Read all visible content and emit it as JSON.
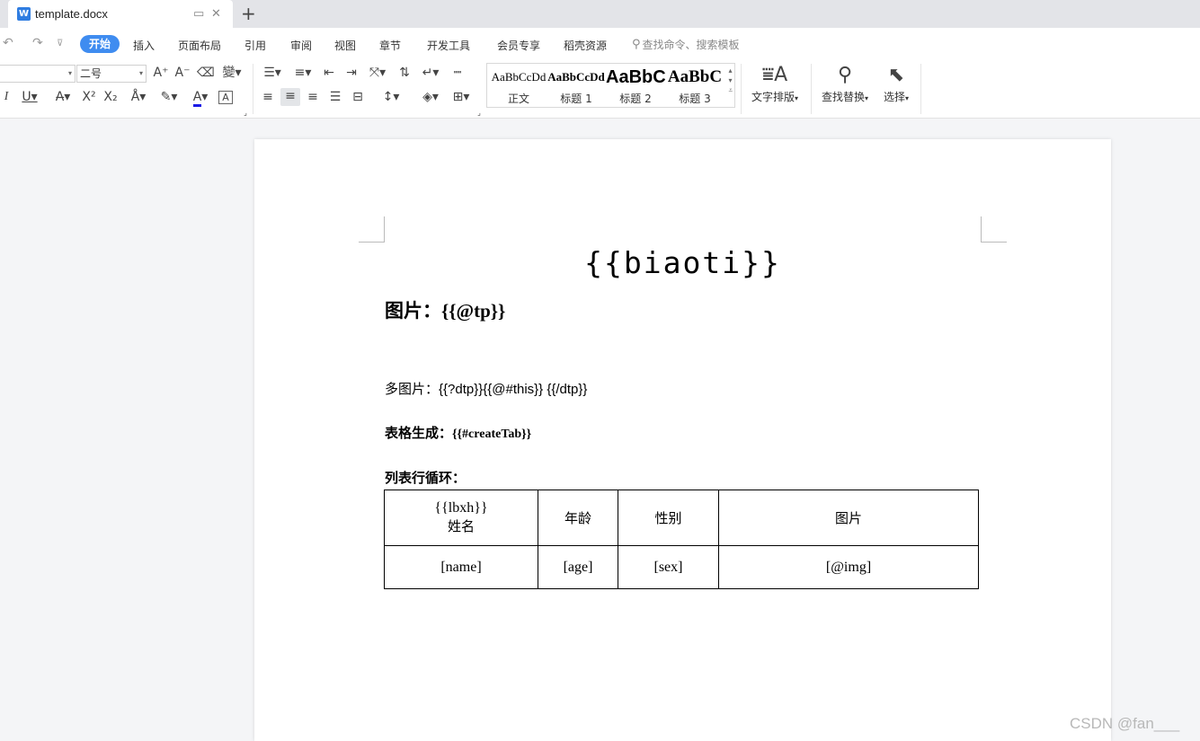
{
  "tabbar": {
    "doc_name": "template.docx",
    "doc_icon": "W",
    "new_tab": "+"
  },
  "menu": {
    "items": [
      "开始",
      "插入",
      "页面布局",
      "引用",
      "审阅",
      "视图",
      "章节",
      "开发工具",
      "会员专享",
      "稻壳资源"
    ],
    "search_placeholder": "查找命令、搜索模板"
  },
  "ribbon": {
    "font_name": "",
    "font_size": "二号",
    "styles": [
      {
        "sample": "AaBbCcDd",
        "name": "正文"
      },
      {
        "sample": "AaBbCcDd",
        "name": "标题 1"
      },
      {
        "sample": "AaBbC",
        "name": "标题 2"
      },
      {
        "sample": "AaBbC",
        "name": "标题 3"
      }
    ],
    "text_layout_label": "文字排版",
    "find_replace_label": "查找替换",
    "select_label": "选择"
  },
  "document": {
    "title": "{{biaoti}}",
    "image_para": "图片：{{@tp}}",
    "multi_image_para": "多图片：{{?dtp}}{{@#this}} {{/dtp}}",
    "table_label": "表格生成：",
    "table_tag": "{{#createTab}}",
    "list_label": "列表行循环：",
    "table": {
      "header": {
        "c1_line1": "{{lbxh}}",
        "c1_line2": "姓名",
        "c2": "年龄",
        "c3": "性别",
        "c4": "图片"
      },
      "row": {
        "c1": "[name]",
        "c2": "[age]",
        "c3": "[sex]",
        "c4": "[@img]"
      }
    }
  },
  "watermark": "CSDN @fan___",
  "colors": {
    "accent": "#3f8cf0",
    "doc_icon": "#2f7de1",
    "tabbar_bg": "#e3e4e8"
  }
}
